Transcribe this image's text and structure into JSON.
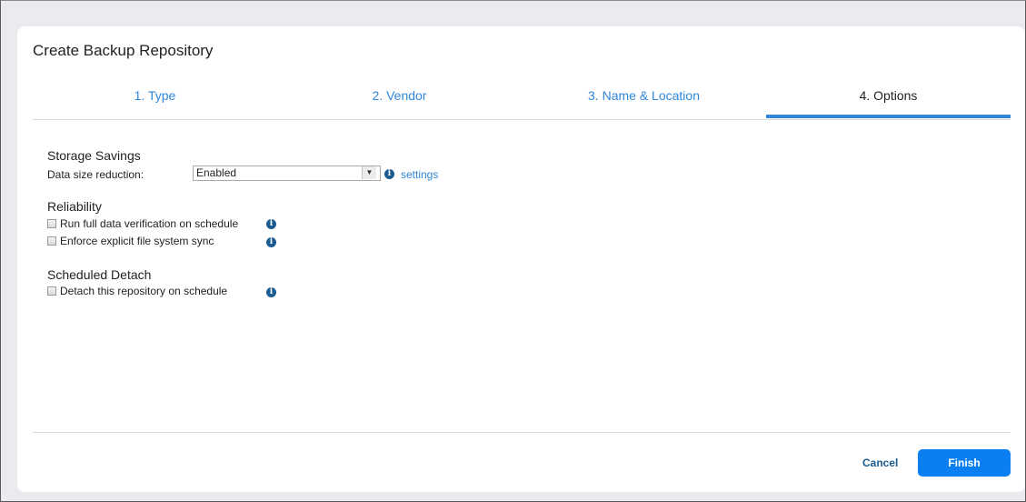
{
  "dialog": {
    "title": "Create Backup Repository"
  },
  "tabs": [
    {
      "label": "1. Type"
    },
    {
      "label": "2. Vendor"
    },
    {
      "label": "3. Name & Location"
    },
    {
      "label": "4. Options"
    }
  ],
  "storage_savings": {
    "title": "Storage Savings",
    "reduction_label": "Data size reduction:",
    "reduction_value": "Enabled",
    "settings_link": "settings"
  },
  "reliability": {
    "title": "Reliability",
    "full_verification_label": "Run full data verification on schedule",
    "fs_sync_label": "Enforce explicit file system sync"
  },
  "scheduled_detach": {
    "title": "Scheduled Detach",
    "detach_label": "Detach this repository on schedule"
  },
  "footer": {
    "cancel_label": "Cancel",
    "finish_label": "Finish"
  },
  "colors": {
    "accent": "#2f86d8",
    "finish_button": "#0b7ff2",
    "info_icon": "#1b5b91"
  }
}
